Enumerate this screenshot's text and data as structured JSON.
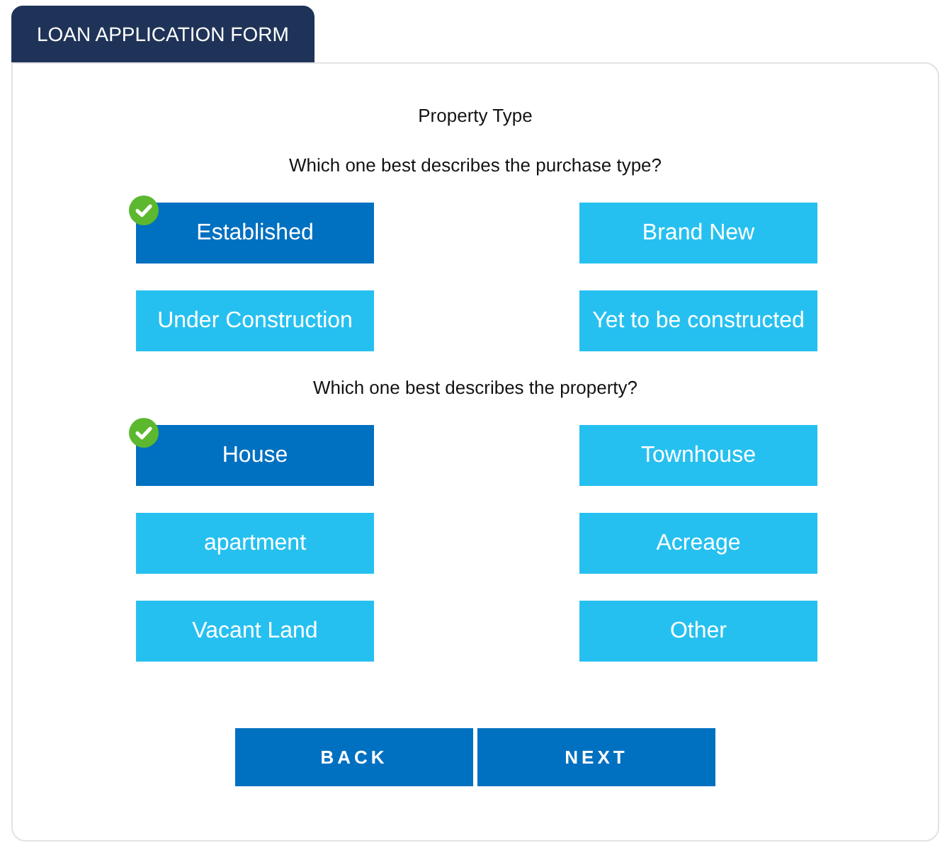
{
  "tab": {
    "title": "LOAN APPLICATION FORM"
  },
  "section": {
    "title": "Property Type"
  },
  "questions": [
    {
      "prompt": "Which one best describes the purchase type?",
      "options": [
        {
          "label": "Established",
          "selected": true
        },
        {
          "label": "Brand New",
          "selected": false
        },
        {
          "label": "Under Construction",
          "selected": false
        },
        {
          "label": "Yet to be constructed",
          "selected": false
        }
      ]
    },
    {
      "prompt": "Which one best describes the property?",
      "options": [
        {
          "label": "House",
          "selected": true
        },
        {
          "label": "Townhouse",
          "selected": false
        },
        {
          "label": "apartment",
          "selected": false
        },
        {
          "label": "Acreage",
          "selected": false
        },
        {
          "label": "Vacant Land",
          "selected": false
        },
        {
          "label": "Other",
          "selected": false
        }
      ]
    }
  ],
  "buttons": [
    {
      "label": "BACK"
    },
    {
      "label": "NEXT"
    }
  ]
}
